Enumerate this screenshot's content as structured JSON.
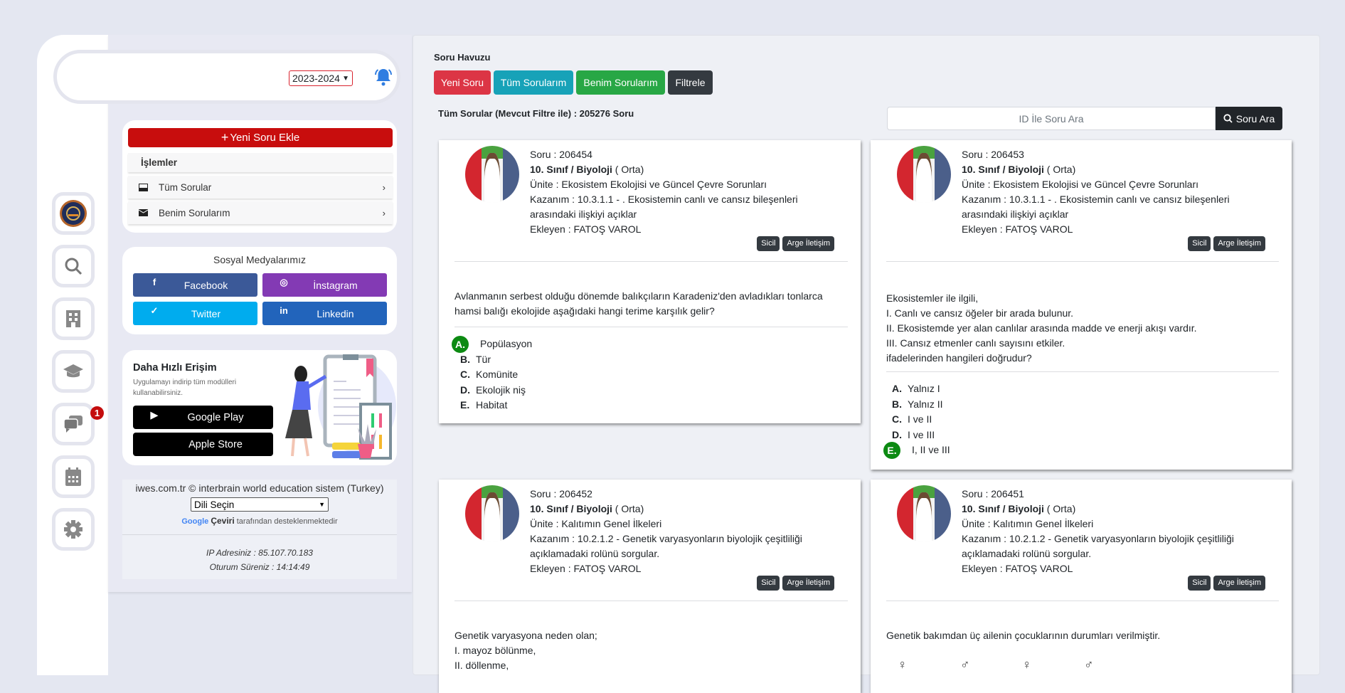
{
  "header": {
    "year": "2023-2024"
  },
  "sidebar": {
    "icons": [
      "logo-seal",
      "search-zoom-icon",
      "building-icon",
      "graduation-cap-icon",
      "chat-icon",
      "calendar-icon",
      "gear-icon"
    ],
    "chat_badge": "1"
  },
  "actions": {
    "add_button": "Yeni Soru Ekle",
    "section_title": "İşlemler",
    "items": [
      {
        "label": "Tüm Sorular",
        "icon": "inbox-icon"
      },
      {
        "label": "Benim Sorularım",
        "icon": "envelope-icon"
      }
    ]
  },
  "social": {
    "title": "Sosyal Medyalarımız",
    "buttons": [
      {
        "label": "Facebook",
        "icon": "f",
        "color": "#3b5998"
      },
      {
        "label": "İnstagram",
        "icon": "◎",
        "color": "#833ab4"
      },
      {
        "label": "Twitter",
        "icon": "🐦",
        "color": "#00acee"
      },
      {
        "label": "Linkedin",
        "icon": "in",
        "color": "#2264bb"
      }
    ]
  },
  "app": {
    "title": "Daha Hızlı Erişim",
    "subtitle": "Uygulamayı indirip tüm modülleri kullanabilirsiniz.",
    "google_play": "Google Play",
    "apple_store": "Apple Store"
  },
  "footer": {
    "copyright": "iwes.com.tr © interbrain world education sistem (Turkey)",
    "language_select": "Dili Seçin",
    "google": "Google",
    "translate": "Çeviri",
    "translate_suffix": "tarafından desteklenmektedir",
    "ip": "IP Adresiniz : 85.107.70.183",
    "session": "Oturum Süreniz : 14:14:49"
  },
  "main": {
    "title": "Soru Havuzu",
    "buttons": [
      {
        "label": "Yeni Soru",
        "color": "#dc3545"
      },
      {
        "label": "Tüm Sorularım",
        "color": "#17a2b8"
      },
      {
        "label": "Benim Sorularım",
        "color": "#28a745"
      },
      {
        "label": "Filtrele",
        "color": "#343a40"
      }
    ],
    "count_text": "Tüm Sorular (Mevcut Filtre ile) : 205276 Soru",
    "search_placeholder": "ID İle Soru Ara",
    "search_button": "Soru Ara"
  },
  "questions": [
    {
      "id": "Soru : 206454",
      "subject": "10. Sınıf / Biyoloji",
      "level": " ( Orta)",
      "unit": "Ünite : Ekosistem Ekolojisi ve Güncel Çevre Sorunları",
      "outcome": "Kazanım : 10.3.1.1 - . Ekosistemin canlı ve cansız bileşenleri arasındaki ilişkiyi açıklar",
      "author": "Ekleyen : FATOŞ VAROL",
      "btn_sicil": "Sicil",
      "btn_arge": "Arge İletişim",
      "text": [
        "Avlanmanın serbest olduğu dönemde balıkçıların Karadeniz'den avladıkları tonlarca hamsi balığı ekolojide aşağıdaki hangi terime karşılık gelir?"
      ],
      "options": [
        {
          "letter": "A.",
          "text": "Popülasyon",
          "correct": true
        },
        {
          "letter": "B.",
          "text": "Tür"
        },
        {
          "letter": "C.",
          "text": "Komünite"
        },
        {
          "letter": "D.",
          "text": "Ekolojik niş"
        },
        {
          "letter": "E.",
          "text": "Habitat"
        }
      ]
    },
    {
      "id": "Soru : 206453",
      "subject": "10. Sınıf / Biyoloji",
      "level": " ( Orta)",
      "unit": "Ünite : Ekosistem Ekolojisi ve Güncel Çevre Sorunları",
      "outcome": "Kazanım : 10.3.1.1 - . Ekosistemin canlı ve cansız bileşenleri arasındaki ilişkiyi açıklar",
      "author": "Ekleyen : FATOŞ VAROL",
      "btn_sicil": "Sicil",
      "btn_arge": "Arge İletişim",
      "text": [
        "Ekosistemler ile ilgili,",
        "I. Canlı ve cansız öğeler bir arada bulunur.",
        "II. Ekosistemde yer alan canlılar arasında madde ve enerji akışı vardır.",
        "III. Cansız etmenler canlı sayısını etkiler.",
        "ifadelerinden hangileri doğrudur?"
      ],
      "options": [
        {
          "letter": "A.",
          "text": "Yalnız I"
        },
        {
          "letter": "B.",
          "text": "Yalnız II"
        },
        {
          "letter": "C.",
          "text": "I ve II"
        },
        {
          "letter": "D.",
          "text": "I ve III"
        },
        {
          "letter": "E.",
          "text": "I, II ve III",
          "correct": true
        }
      ]
    },
    {
      "id": "Soru : 206452",
      "subject": "10. Sınıf / Biyoloji",
      "level": " ( Orta)",
      "unit": "Ünite : Kalıtımın Genel İlkeleri",
      "outcome": "Kazanım : 10.2.1.2 - Genetik varyasyonların biyolojik çeşitliliği açıklamadaki rolünü sorgular.",
      "author": "Ekleyen : FATOŞ VAROL",
      "btn_sicil": "Sicil",
      "btn_arge": "Arge İletişim",
      "text": [
        "Genetik varyasyona neden olan;",
        "I. mayoz bölünme,",
        "II. döllenme,"
      ],
      "options": []
    },
    {
      "id": "Soru : 206451",
      "subject": "10. Sınıf / Biyoloji",
      "level": " ( Orta)",
      "unit": "Ünite : Kalıtımın Genel İlkeleri",
      "outcome": "Kazanım : 10.2.1.2 - Genetik varyasyonların biyolojik çeşitliliği açıklamadaki rolünü sorgular.",
      "author": "Ekleyen : FATOŞ VAROL",
      "btn_sicil": "Sicil",
      "btn_arge": "Arge İletişim",
      "text": [
        "Genetik bakımdan üç ailenin çocuklarının durumları verilmiştir."
      ],
      "symbols": [
        "♀",
        "♂",
        "♀",
        "♂"
      ],
      "options": []
    }
  ]
}
